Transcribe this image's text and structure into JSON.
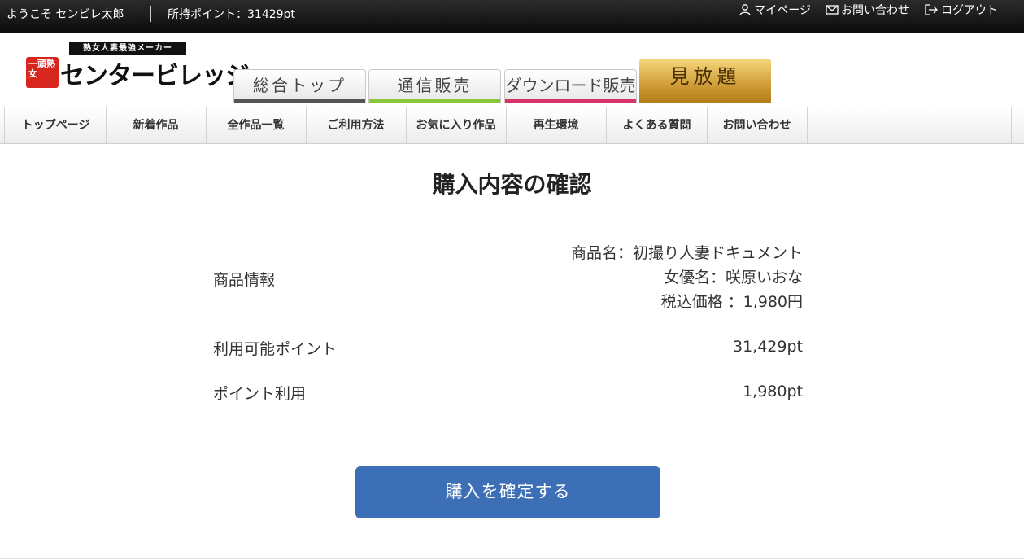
{
  "topbar": {
    "welcome": "ようこそ センビレ太郎",
    "points": "所持ポイント：31429pt",
    "links": [
      {
        "icon": "person-icon",
        "label": "マイページ"
      },
      {
        "icon": "mail-icon",
        "label": "お問い合わせ"
      },
      {
        "icon": "logout-icon",
        "label": "ログアウト"
      }
    ]
  },
  "logo": {
    "tagline": "熟女人妻最強メーカー",
    "seal": "一頭熟女",
    "brand": "センタービレッジ"
  },
  "tabs": [
    {
      "label": "総合トップ",
      "color": "#555555"
    },
    {
      "label": "通信販売",
      "color": "#8cc63f"
    },
    {
      "label": "ダウンロード販売",
      "color": "#d6336c"
    },
    {
      "label": "見放題",
      "color": "#c8922c"
    }
  ],
  "nav": [
    "トップページ",
    "新着作品",
    "全作品一覧",
    "ご利用方法",
    "お気に入り作品",
    "再生環境",
    "よくある質問",
    "お問い合わせ"
  ],
  "page": {
    "title": "購入内容の確認",
    "product_label": "商品情報",
    "product_name": "商品名：初撮り人妻ドキュメント",
    "actress": "女優名：咲原いおな",
    "price": "税込価格 ：1,980円",
    "available_label": "利用可能ポイント",
    "available_value": "31,429pt",
    "use_label": "ポイント利用",
    "use_value": "1,980pt",
    "confirm_button": "購入を確定する"
  },
  "colors": {
    "topbar": "#111111",
    "button": "#3d6fb6",
    "logo_red": "#d7261e"
  }
}
